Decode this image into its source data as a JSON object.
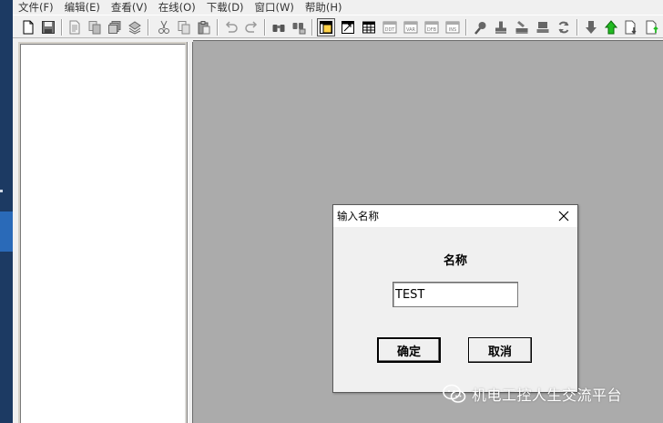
{
  "menu": [
    "文件(F)",
    "编辑(E)",
    "查看(V)",
    "在线(O)",
    "下载(D)",
    "窗口(W)",
    "帮助(H)"
  ],
  "toolbar_icons": [
    "new-file-icon",
    "save-icon",
    "page-icon",
    "copy-page-icon",
    "stack-icon",
    "layers-icon",
    "cut-icon",
    "copy-icon",
    "paste-icon",
    "undo-icon",
    "redo-icon",
    "find-icon",
    "replace-icon",
    "view-tree-icon",
    "view-logic-icon",
    "view-table-icon",
    "ddt-icon",
    "var-icon",
    "dfb-icon",
    "ins-icon",
    "search-icon",
    "stamp-icon",
    "print-icon",
    "pc-icon",
    "refresh-icon",
    "arrow-down-icon",
    "arrow-up-green-icon",
    "download-doc-icon",
    "upload-doc-icon"
  ],
  "toolbar_text": {
    "ddt": "DDT",
    "var": "VAR",
    "dfb": "DFB",
    "ins": "INS"
  },
  "dialog": {
    "title": "输入名称",
    "label": "名称",
    "input_value": "TEST",
    "ok": "确定",
    "cancel": "取消"
  },
  "watermark": "机电工控人生交流平台",
  "colors": {
    "workspace": "#ababab",
    "green_arrow": "#22bb22",
    "desktop": "#1c3a63"
  }
}
